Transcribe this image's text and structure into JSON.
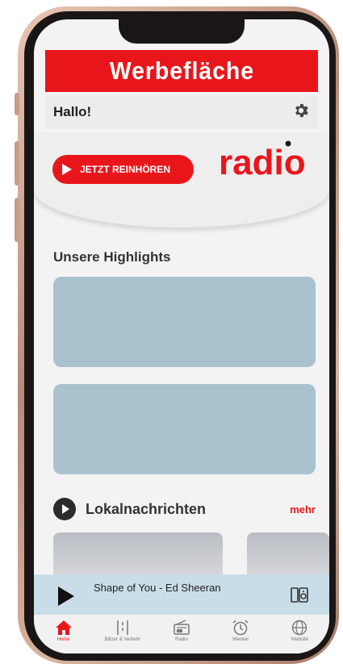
{
  "ad_banner": {
    "text": "Werbefläche"
  },
  "header": {
    "greeting": "Hallo!",
    "settings_icon": "gear-icon"
  },
  "hero": {
    "listen_button": "JETZT REINHÖREN",
    "logo_text": "radio"
  },
  "highlights": {
    "title": "Unsere Highlights",
    "card_count": 2
  },
  "news": {
    "title": "Lokalnachrichten",
    "more": "mehr"
  },
  "player": {
    "song": "Shape of You - Ed Sheeran"
  },
  "tabs": [
    {
      "label": "Home",
      "icon": "home-icon",
      "active": true
    },
    {
      "label": "Blitzer & Verkehr",
      "icon": "traffic-icon",
      "active": false
    },
    {
      "label": "Radio",
      "icon": "radio-icon",
      "active": false
    },
    {
      "label": "Wecker",
      "icon": "alarm-icon",
      "active": false
    },
    {
      "label": "Website",
      "icon": "globe-icon",
      "active": false
    }
  ],
  "colors": {
    "brand_red": "#e8161b",
    "card": "#a9c2cd",
    "player": "#c9dde8"
  }
}
